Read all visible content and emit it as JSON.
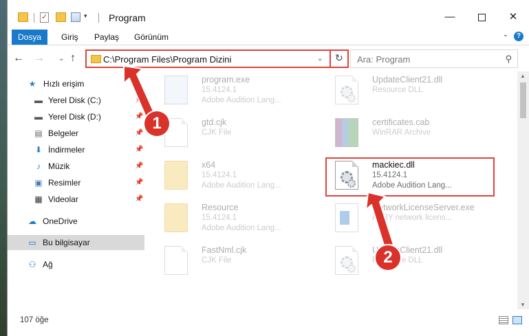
{
  "window": {
    "title": "Program",
    "min_label": "—",
    "close_label": "✕",
    "qa_check_glyph": "✓",
    "qa_drop_glyph": "▾"
  },
  "ribbon": {
    "tabs": [
      "Dosya",
      "Giriş",
      "Paylaş",
      "Görünüm"
    ],
    "chevron": "⌄",
    "help": "?"
  },
  "nav": {
    "back": "←",
    "forward": "→",
    "recent": "⌄",
    "up": "↑",
    "address": "C:\\Program Files\\Program Dizini",
    "address_drop": "⌄",
    "refresh": "↻",
    "search_placeholder": "Ara: Program",
    "search_glyph": "⚲"
  },
  "sidebar": {
    "items": [
      {
        "label": "Hızlı erişim",
        "icon": "★",
        "pinned": false
      },
      {
        "label": "Yerel Disk (C:)",
        "icon": "▬",
        "pinned": true
      },
      {
        "label": "Yerel Disk (D:)",
        "icon": "▬",
        "pinned": true
      },
      {
        "label": "Belgeler",
        "icon": "▤",
        "pinned": true
      },
      {
        "label": "İndirmeler",
        "icon": "⬇",
        "pinned": true
      },
      {
        "label": "Müzik",
        "icon": "♪",
        "pinned": true
      },
      {
        "label": "Resimler",
        "icon": "▣",
        "pinned": true
      },
      {
        "label": "Videolar",
        "icon": "▦",
        "pinned": true
      },
      {
        "label": "OneDrive",
        "icon": "☁",
        "pinned": false
      },
      {
        "label": "Bu bilgisayar",
        "icon": "▭",
        "pinned": false
      },
      {
        "label": "Ağ",
        "icon": "⚇",
        "pinned": false
      }
    ],
    "pin_glyph": "📌"
  },
  "files": [
    {
      "name": "program.exe",
      "line1": "15.4124.1",
      "line2": "Adobe Audition Lang...",
      "kind": "exe"
    },
    {
      "name": "UpdateClient21.dll",
      "line1": "Resource DLL",
      "line2": "",
      "kind": "dll"
    },
    {
      "name": "gtd.cjk",
      "line1": "CJK File",
      "line2": "",
      "kind": "doc"
    },
    {
      "name": "certificates.cab",
      "line1": "WinRAR Archive",
      "line2": "",
      "kind": "rar"
    },
    {
      "name": "x64",
      "line1": "15.4124.1",
      "line2": "Adobe Audition Lang...",
      "kind": "folder"
    },
    {
      "name": "mackiec.dll",
      "line1": "15.4124.1",
      "line2": "Adobe Audition Lang...",
      "kind": "dll"
    },
    {
      "name": "Resource",
      "line1": "15.4124.1",
      "line2": "Adobe Audition Lang...",
      "kind": "folder"
    },
    {
      "name": "NetworkLicenseServer.exe",
      "line1": "ABBY network licens...",
      "line2": "",
      "kind": "net"
    },
    {
      "name": "FastNml.cjk",
      "line1": "CJK File",
      "line2": "",
      "kind": "doc"
    },
    {
      "name": "UpdateClient21.dll",
      "line1": "Resource DLL",
      "line2": "",
      "kind": "dll"
    }
  ],
  "status": {
    "count": "107 öğe"
  },
  "annotations": {
    "marker1": "1",
    "marker2": "2",
    "color": "#d9322b"
  }
}
